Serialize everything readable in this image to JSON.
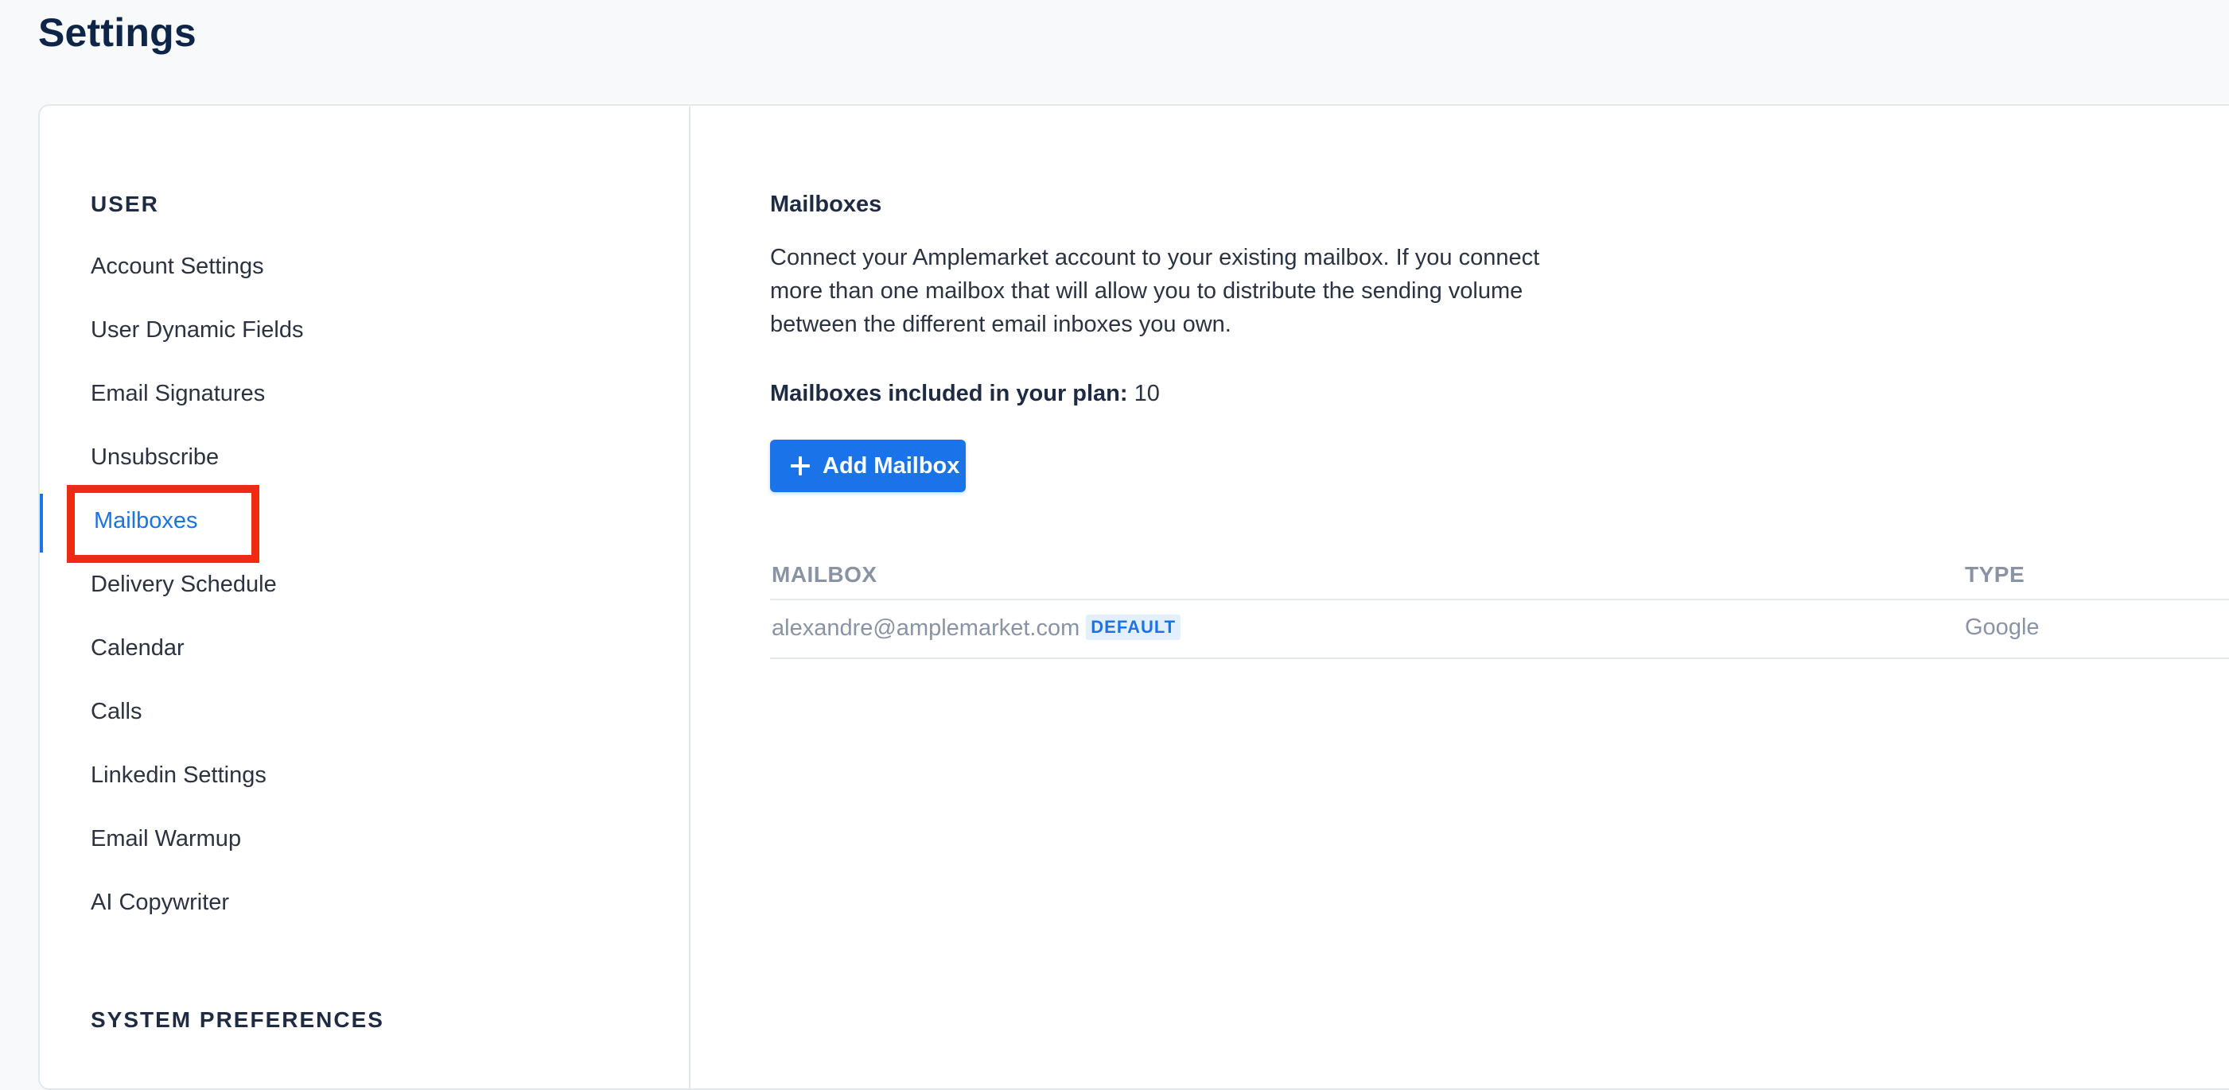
{
  "page": {
    "title": "Settings"
  },
  "sidebar": {
    "user_heading": "USER",
    "items": [
      {
        "label": "Account Settings"
      },
      {
        "label": "User Dynamic Fields"
      },
      {
        "label": "Email Signatures"
      },
      {
        "label": "Unsubscribe"
      },
      {
        "label": "Mailboxes",
        "active": true
      },
      {
        "label": "Delivery Schedule"
      },
      {
        "label": "Calendar"
      },
      {
        "label": "Calls"
      },
      {
        "label": "Linkedin Settings"
      },
      {
        "label": "Email Warmup"
      },
      {
        "label": "AI Copywriter"
      }
    ],
    "system_heading": "SYSTEM PREFERENCES"
  },
  "main": {
    "title": "Mailboxes",
    "description": "Connect your Amplemarket account to your existing mailbox. If you connect more than one mailbox that will allow you to distribute the sending volume between the different email inboxes you own.",
    "plan_label": "Mailboxes included in your plan:",
    "plan_value": "10",
    "add_button_label": "Add Mailbox",
    "table": {
      "columns": [
        "MAILBOX",
        "TYPE"
      ],
      "rows": [
        {
          "email": "alexandre@amplemarket.com",
          "badge": "DEFAULT",
          "type": "Google"
        }
      ]
    }
  },
  "colors": {
    "accent": "#1a73e8",
    "highlight": "#ee2a15",
    "title": "#0f2547"
  },
  "icons": {
    "add_button_icon": "plus-icon"
  }
}
